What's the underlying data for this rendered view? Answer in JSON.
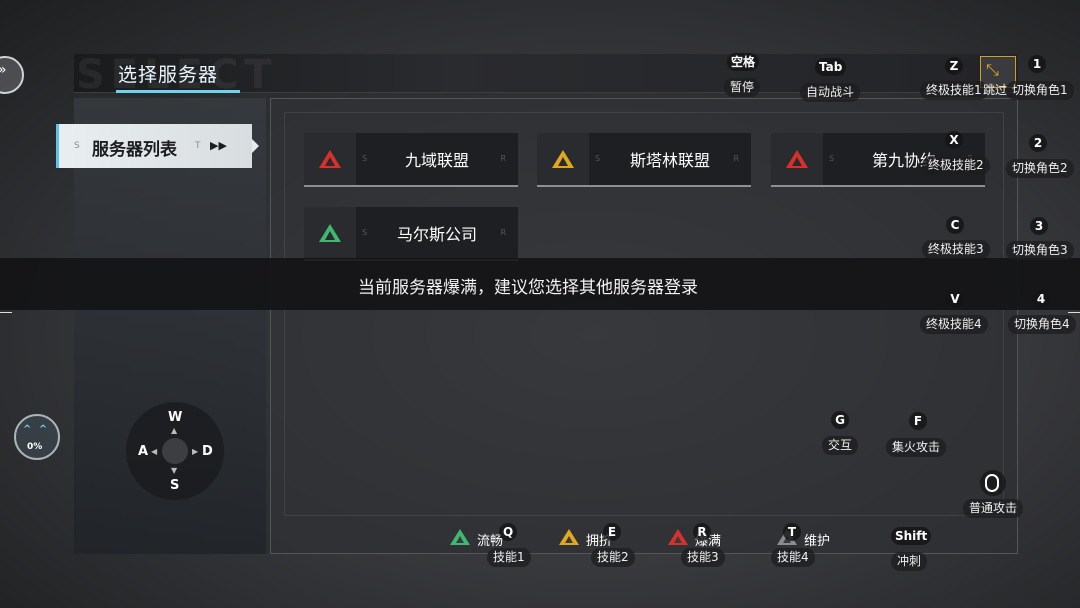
{
  "header": {
    "title": "选择服务器",
    "bg_watermark": "SELECT"
  },
  "sidebar": {
    "tab_label": "服务器列表",
    "tab_s": "S",
    "tab_t": "T"
  },
  "servers": [
    {
      "name": "九域联盟",
      "status_color": "#d9302c"
    },
    {
      "name": "斯塔林联盟",
      "status_color": "#e0a81c"
    },
    {
      "name": "第九协约",
      "status_color": "#d9302c"
    },
    {
      "name": "马尔斯公司",
      "status_color": "#3fb871"
    }
  ],
  "card_corner_labels": {
    "left": "S",
    "right": "R"
  },
  "toast": {
    "message": "当前服务器爆满，建议您选择其他服务器登录"
  },
  "key_hints": {
    "pause": {
      "key": "空格",
      "label": "暂停"
    },
    "auto": {
      "key": "Tab",
      "label": "自动战斗"
    },
    "skip": {
      "label": "跳过"
    },
    "ult1": {
      "key": "Z",
      "label": "终极技能1"
    },
    "ult2": {
      "key": "X",
      "label": "终极技能2"
    },
    "ult3": {
      "key": "C",
      "label": "终极技能3"
    },
    "ult4": {
      "key": "V",
      "label": "终极技能4"
    },
    "switch1": {
      "key": "1",
      "label": "切换角色1"
    },
    "switch2": {
      "key": "2",
      "label": "切换角色2"
    },
    "switch3": {
      "key": "3",
      "label": "切换角色3"
    },
    "switch4": {
      "key": "4",
      "label": "切换角色4"
    },
    "interact": {
      "key": "G",
      "label": "交互"
    },
    "focus": {
      "key": "F",
      "label": "集火攻击"
    },
    "attack": {
      "label": "普通攻击"
    },
    "skill1": {
      "key": "Q",
      "label": "技能1"
    },
    "skill2": {
      "key": "E",
      "label": "技能2"
    },
    "skill3": {
      "key": "R",
      "label": "技能3"
    },
    "skill4": {
      "key": "T",
      "label": "技能4"
    },
    "dash": {
      "key": "Shift",
      "label": "冲刺"
    }
  },
  "joystick": {
    "up": "W",
    "left": "A",
    "right": "D",
    "down": "S"
  },
  "mood": {
    "percent": "0%"
  },
  "legend": [
    {
      "name": "流畅",
      "color": "#3fb871"
    },
    {
      "name": "拥挤",
      "color": "#e0a81c"
    },
    {
      "name": "爆满",
      "color": "#d9302c"
    },
    {
      "name": "维护",
      "color": "#8a8c90"
    }
  ]
}
